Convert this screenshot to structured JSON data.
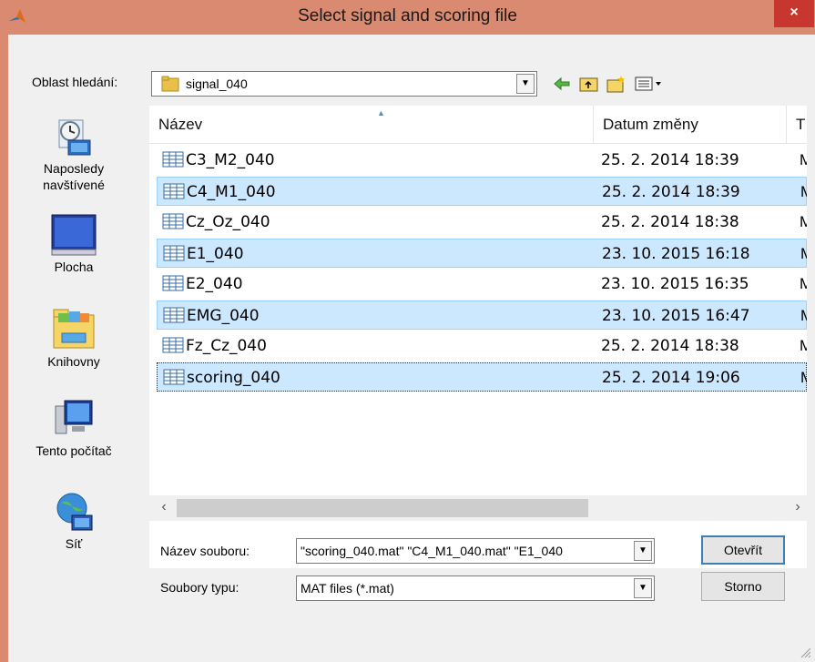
{
  "window": {
    "title": "Select signal and scoring file",
    "close_label": "×"
  },
  "look_in": {
    "label": "Oblast hledání:",
    "value": "signal_040"
  },
  "places": [
    {
      "id": "recent",
      "label_line1": "Naposledy",
      "label_line2": "navštívené",
      "icon": "recent-places-icon"
    },
    {
      "id": "desktop",
      "label_line1": "Plocha",
      "label_line2": "",
      "icon": "desktop-icon"
    },
    {
      "id": "libraries",
      "label_line1": "Knihovny",
      "label_line2": "",
      "icon": "libraries-icon"
    },
    {
      "id": "computer",
      "label_line1": "Tento počítač",
      "label_line2": "",
      "icon": "computer-icon"
    },
    {
      "id": "network",
      "label_line1": "Síť",
      "label_line2": "",
      "icon": "network-icon"
    }
  ],
  "file_list": {
    "columns": {
      "name": "Název",
      "date": "Datum změny",
      "type": "T"
    },
    "rows": [
      {
        "name": "C3_M2_040",
        "date": "25. 2. 2014 18:39",
        "type": "M",
        "selected": false
      },
      {
        "name": "C4_M1_040",
        "date": "25. 2. 2014 18:39",
        "type": "M",
        "selected": true
      },
      {
        "name": "Cz_Oz_040",
        "date": "25. 2. 2014 18:38",
        "type": "M",
        "selected": false
      },
      {
        "name": "E1_040",
        "date": "23. 10. 2015 16:18",
        "type": "M",
        "selected": true
      },
      {
        "name": "E2_040",
        "date": "23. 10. 2015 16:35",
        "type": "M",
        "selected": false
      },
      {
        "name": "EMG_040",
        "date": "23. 10. 2015 16:47",
        "type": "M",
        "selected": true
      },
      {
        "name": "Fz_Cz_040",
        "date": "25. 2. 2014 18:38",
        "type": "M",
        "selected": false
      },
      {
        "name": "scoring_040",
        "date": "25. 2. 2014 19:06",
        "type": "M",
        "selected": true
      }
    ]
  },
  "filename": {
    "label": "Název souboru:",
    "value": "\"scoring_040.mat\" \"C4_M1_040.mat\" \"E1_040"
  },
  "filetype": {
    "label": "Soubory typu:",
    "value": "MAT files (*.mat)"
  },
  "buttons": {
    "open": "Otevřít",
    "cancel": "Storno"
  }
}
